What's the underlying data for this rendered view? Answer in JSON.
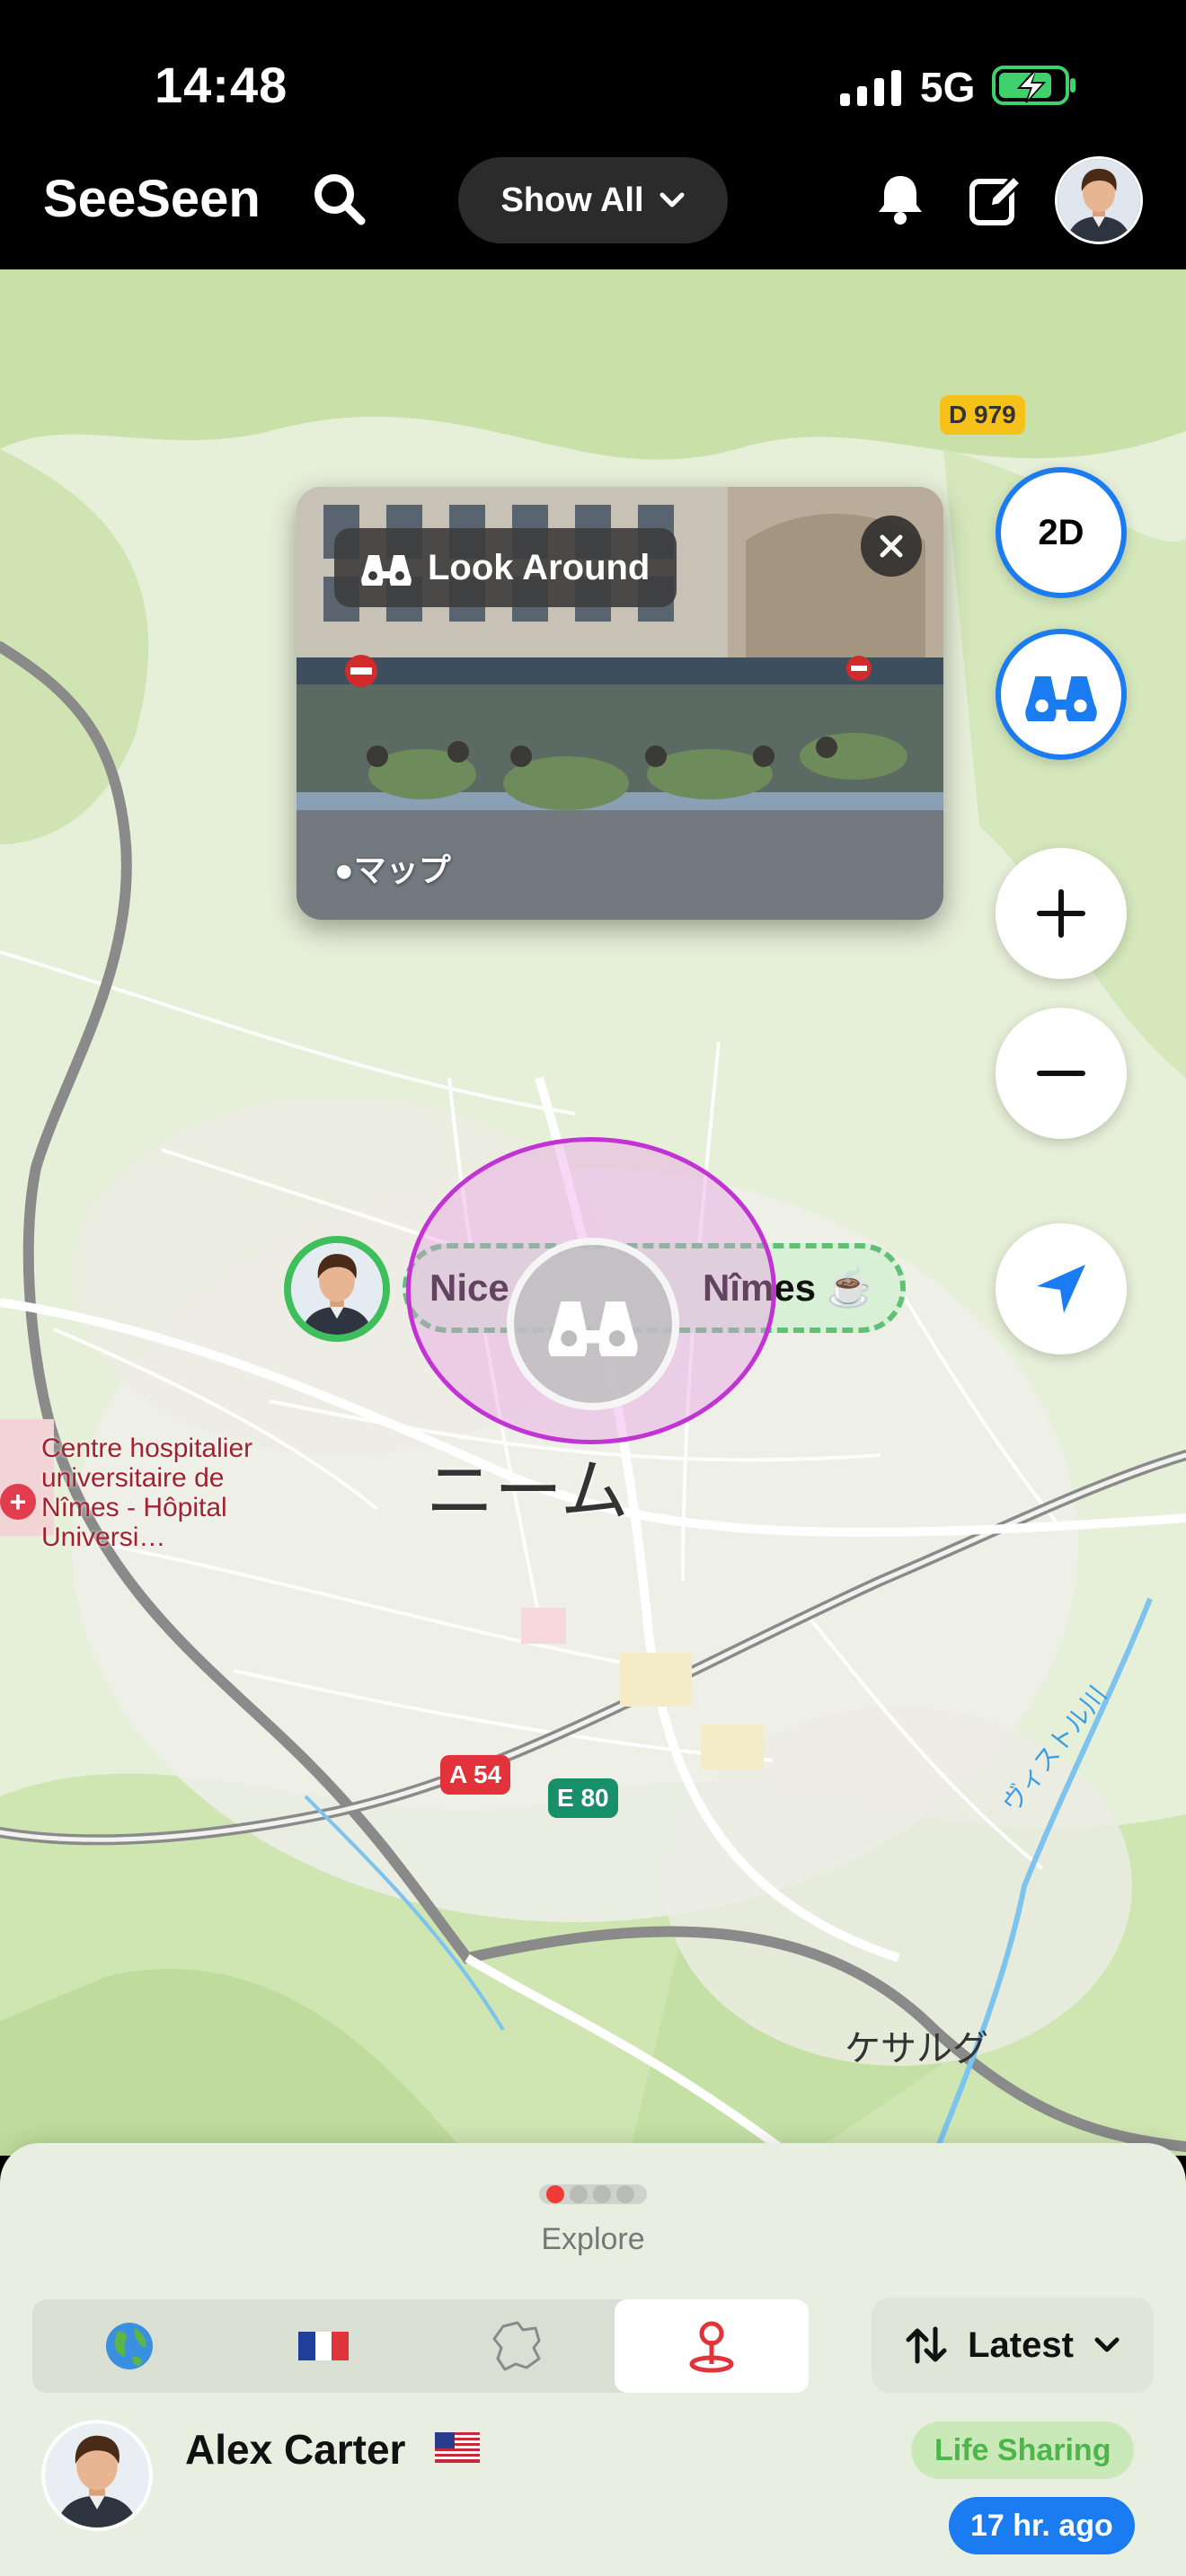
{
  "status_bar": {
    "time": "14:48",
    "network": "5G"
  },
  "header": {
    "brand": "SeeSeen",
    "filter_label": "Show All"
  },
  "map": {
    "look_around": {
      "label": "Look Around",
      "provider": "マップ"
    },
    "controls": {
      "view_mode": "2D"
    },
    "road_badges": {
      "d979": "D 979",
      "a54": "A 54",
      "e80": "E 80"
    },
    "marker": {
      "label_left": "Nice",
      "label_right": "Nîmes ☕️"
    },
    "places": {
      "hospital": "Centre hospitalier universitaire de Nîmes - Hôpital Universi…",
      "city": "ニーム",
      "town": "ケサルグ",
      "river": "ヴィストル川"
    }
  },
  "sheet": {
    "title": "Explore",
    "sort_label": "Latest",
    "tabs": [
      "world",
      "france",
      "region",
      "pin"
    ],
    "active_tab": "pin",
    "feed_item": {
      "name": "Alex Carter",
      "badge": "Life Sharing",
      "time": "17 hr. ago"
    }
  },
  "colors": {
    "accent": "#1a7cf0",
    "marker_ring": "#3fbf5b",
    "circle": "#c233d4",
    "sheet_bg": "#e8eee0"
  }
}
